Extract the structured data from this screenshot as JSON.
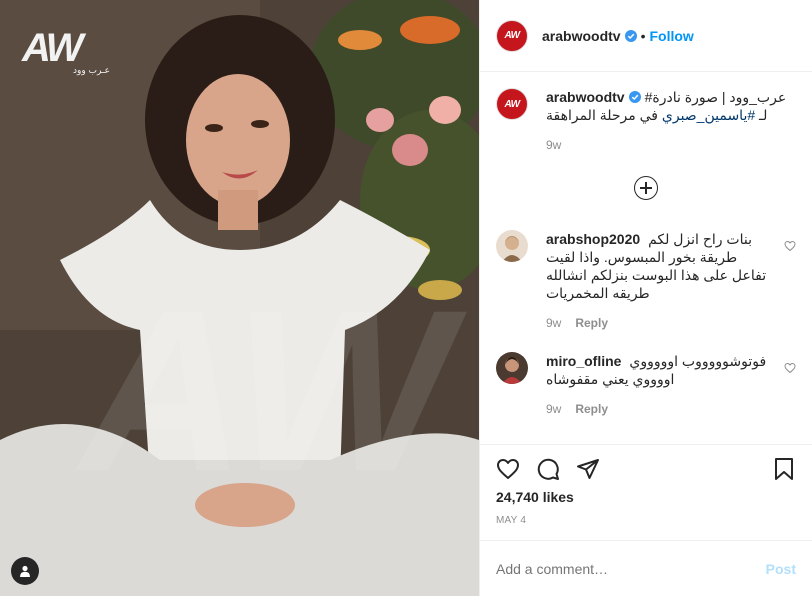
{
  "photo": {
    "watermark_letters": "AW",
    "watermark_sub": "عـرب وود"
  },
  "header": {
    "avatar_text": "AW",
    "username": "arabwoodtv",
    "dot": "•",
    "follow_label": "Follow"
  },
  "caption": {
    "avatar_text": "AW",
    "username": "arabwoodtv",
    "line1": "عرب_وود | صورة نادرة# ",
    "line2_prefix": "لـ ",
    "hashtag": "#ياسمين_صبري",
    "line2_suffix": " في مرحلة المراهقة",
    "time": "9w"
  },
  "comments": [
    {
      "username": "arabshop2020",
      "text": "بنات راح انزل لكم طريقة بخور المبسوس. واذا لقيت تفاعل على هذا البوست بنزلكم انشالله طريقه المخمريات",
      "time": "9w",
      "reply": "Reply"
    },
    {
      "username": "miro_ofline",
      "text": "فوتوشوووووب اوووووي اووووي يعني مقفوشاه",
      "time": "9w",
      "reply": "Reply"
    }
  ],
  "likes": "24,740 likes",
  "date": "MAY 4",
  "add_comment": {
    "placeholder": "Add a comment…",
    "post_label": "Post"
  },
  "colors": {
    "follow": "#0095f6",
    "brand_red": "#c4161c",
    "post_disabled": "#b2dffc"
  }
}
